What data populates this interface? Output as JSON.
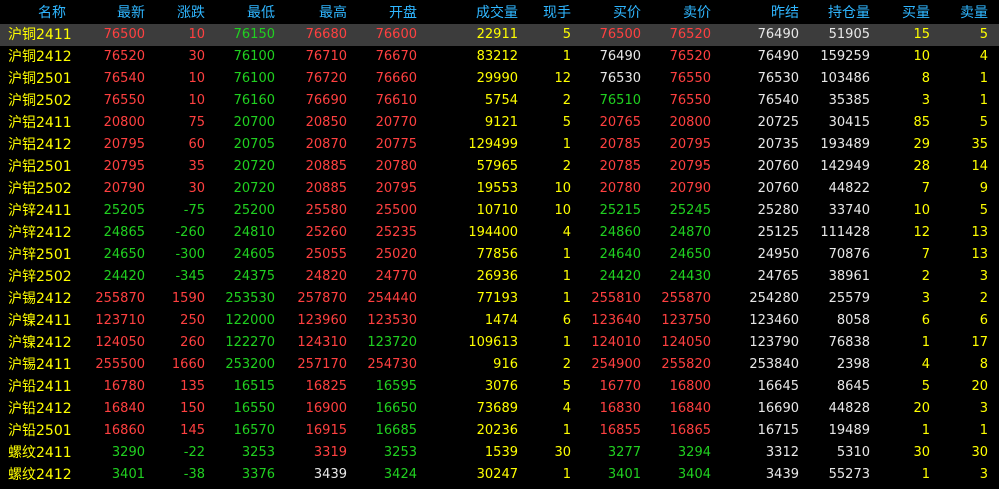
{
  "header": {
    "name": "名称",
    "latest": "最新",
    "change": "涨跌",
    "low": "最低",
    "high": "最高",
    "open": "开盘",
    "volume": "成交量",
    "now_vol": "现手",
    "bid": "买价",
    "ask": "卖价",
    "prev_settle": "昨结",
    "open_interest": "持仓量",
    "bid_qty": "买量",
    "ask_qty": "卖量"
  },
  "colors": {
    "up": "#ff4040",
    "down": "#20d020",
    "flat": "#e8e8e8",
    "volume": "#ffff00",
    "header": "#2fb6ff"
  },
  "rows": [
    {
      "name": "沪铜2411",
      "latest": "76500",
      "change": "10",
      "low": "76150",
      "high": "76680",
      "open": "76600",
      "volume": "22911",
      "now": "5",
      "bid": "76500",
      "ask": "76520",
      "pre": "76490",
      "oi": "51905",
      "bq": "15",
      "aq": "5"
    },
    {
      "name": "沪铜2412",
      "latest": "76520",
      "change": "30",
      "low": "76100",
      "high": "76710",
      "open": "76670",
      "volume": "83212",
      "now": "1",
      "bid": "76490",
      "ask": "76520",
      "pre": "76490",
      "oi": "159259",
      "bq": "10",
      "aq": "4"
    },
    {
      "name": "沪铜2501",
      "latest": "76540",
      "change": "10",
      "low": "76100",
      "high": "76720",
      "open": "76660",
      "volume": "29990",
      "now": "12",
      "bid": "76530",
      "ask": "76550",
      "pre": "76530",
      "oi": "103486",
      "bq": "8",
      "aq": "1"
    },
    {
      "name": "沪铜2502",
      "latest": "76550",
      "change": "10",
      "low": "76160",
      "high": "76690",
      "open": "76610",
      "volume": "5754",
      "now": "2",
      "bid": "76510",
      "ask": "76550",
      "pre": "76540",
      "oi": "35385",
      "bq": "3",
      "aq": "1"
    },
    {
      "name": "沪铝2411",
      "latest": "20800",
      "change": "75",
      "low": "20700",
      "high": "20850",
      "open": "20770",
      "volume": "9121",
      "now": "5",
      "bid": "20765",
      "ask": "20800",
      "pre": "20725",
      "oi": "30415",
      "bq": "85",
      "aq": "5"
    },
    {
      "name": "沪铝2412",
      "latest": "20795",
      "change": "60",
      "low": "20705",
      "high": "20870",
      "open": "20775",
      "volume": "129499",
      "now": "1",
      "bid": "20785",
      "ask": "20795",
      "pre": "20735",
      "oi": "193489",
      "bq": "29",
      "aq": "35"
    },
    {
      "name": "沪铝2501",
      "latest": "20795",
      "change": "35",
      "low": "20720",
      "high": "20885",
      "open": "20780",
      "volume": "57965",
      "now": "2",
      "bid": "20785",
      "ask": "20795",
      "pre": "20760",
      "oi": "142949",
      "bq": "28",
      "aq": "14"
    },
    {
      "name": "沪铝2502",
      "latest": "20790",
      "change": "30",
      "low": "20720",
      "high": "20885",
      "open": "20795",
      "volume": "19553",
      "now": "10",
      "bid": "20780",
      "ask": "20790",
      "pre": "20760",
      "oi": "44822",
      "bq": "7",
      "aq": "9"
    },
    {
      "name": "沪锌2411",
      "latest": "25205",
      "change": "-75",
      "low": "25200",
      "high": "25580",
      "open": "25500",
      "volume": "10710",
      "now": "10",
      "bid": "25215",
      "ask": "25245",
      "pre": "25280",
      "oi": "33740",
      "bq": "10",
      "aq": "5"
    },
    {
      "name": "沪锌2412",
      "latest": "24865",
      "change": "-260",
      "low": "24810",
      "high": "25260",
      "open": "25235",
      "volume": "194400",
      "now": "4",
      "bid": "24860",
      "ask": "24870",
      "pre": "25125",
      "oi": "111428",
      "bq": "12",
      "aq": "13"
    },
    {
      "name": "沪锌2501",
      "latest": "24650",
      "change": "-300",
      "low": "24605",
      "high": "25055",
      "open": "25020",
      "volume": "77856",
      "now": "1",
      "bid": "24640",
      "ask": "24650",
      "pre": "24950",
      "oi": "70876",
      "bq": "7",
      "aq": "13"
    },
    {
      "name": "沪锌2502",
      "latest": "24420",
      "change": "-345",
      "low": "24375",
      "high": "24820",
      "open": "24770",
      "volume": "26936",
      "now": "1",
      "bid": "24420",
      "ask": "24430",
      "pre": "24765",
      "oi": "38961",
      "bq": "2",
      "aq": "3"
    },
    {
      "name": "沪锡2412",
      "latest": "255870",
      "change": "1590",
      "low": "253530",
      "high": "257870",
      "open": "254440",
      "volume": "77193",
      "now": "1",
      "bid": "255810",
      "ask": "255870",
      "pre": "254280",
      "oi": "25579",
      "bq": "3",
      "aq": "2"
    },
    {
      "name": "沪镍2411",
      "latest": "123710",
      "change": "250",
      "low": "122000",
      "high": "123960",
      "open": "123530",
      "volume": "1474",
      "now": "6",
      "bid": "123640",
      "ask": "123750",
      "pre": "123460",
      "oi": "8058",
      "bq": "6",
      "aq": "6"
    },
    {
      "name": "沪镍2412",
      "latest": "124050",
      "change": "260",
      "low": "122270",
      "high": "124310",
      "open": "123720",
      "volume": "109613",
      "now": "1",
      "bid": "124010",
      "ask": "124050",
      "pre": "123790",
      "oi": "76838",
      "bq": "1",
      "aq": "17"
    },
    {
      "name": "沪锡2411",
      "latest": "255500",
      "change": "1660",
      "low": "253200",
      "high": "257170",
      "open": "254730",
      "volume": "916",
      "now": "2",
      "bid": "254900",
      "ask": "255820",
      "pre": "253840",
      "oi": "2398",
      "bq": "4",
      "aq": "8"
    },
    {
      "name": "沪铅2411",
      "latest": "16780",
      "change": "135",
      "low": "16515",
      "high": "16825",
      "open": "16595",
      "volume": "3076",
      "now": "5",
      "bid": "16770",
      "ask": "16800",
      "pre": "16645",
      "oi": "8645",
      "bq": "5",
      "aq": "20"
    },
    {
      "name": "沪铅2412",
      "latest": "16840",
      "change": "150",
      "low": "16550",
      "high": "16900",
      "open": "16650",
      "volume": "73689",
      "now": "4",
      "bid": "16830",
      "ask": "16840",
      "pre": "16690",
      "oi": "44828",
      "bq": "20",
      "aq": "3"
    },
    {
      "name": "沪铅2501",
      "latest": "16860",
      "change": "145",
      "low": "16570",
      "high": "16915",
      "open": "16685",
      "volume": "20236",
      "now": "1",
      "bid": "16855",
      "ask": "16865",
      "pre": "16715",
      "oi": "19489",
      "bq": "1",
      "aq": "1"
    },
    {
      "name": "螺纹2411",
      "latest": "3290",
      "change": "-22",
      "low": "3253",
      "high": "3319",
      "open": "3253",
      "volume": "1539",
      "now": "30",
      "bid": "3277",
      "ask": "3294",
      "pre": "3312",
      "oi": "5310",
      "bq": "30",
      "aq": "30"
    },
    {
      "name": "螺纹2412",
      "latest": "3401",
      "change": "-38",
      "low": "3376",
      "high": "3439",
      "open": "3424",
      "volume": "30247",
      "now": "1",
      "bid": "3401",
      "ask": "3404",
      "pre": "3439",
      "oi": "55273",
      "bq": "1",
      "aq": "3"
    }
  ]
}
